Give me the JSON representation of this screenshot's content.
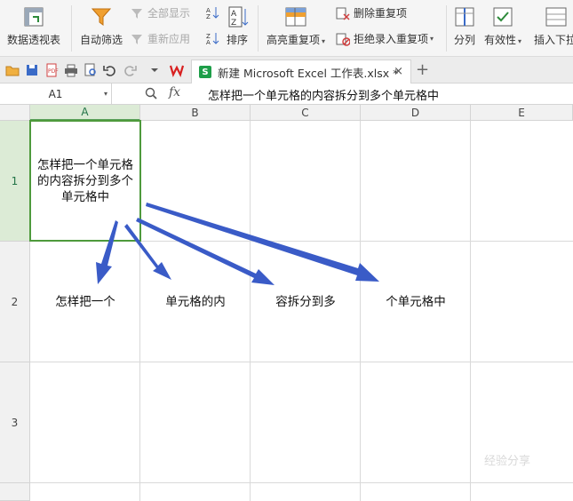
{
  "ribbon": {
    "pivot_table": "数据透视表",
    "auto_filter": "自动筛选",
    "show_all": "全部显示",
    "reapply": "重新应用",
    "sort": "排序",
    "highlight_duplicates": "高亮重复项",
    "delete_duplicates": "删除重复项",
    "reject_duplicates": "拒绝录入重复项",
    "split_column": "分列",
    "validity": "有效性",
    "insert_dropdown": "插入下拉"
  },
  "tabbar": {
    "doc_title": "新建 Microsoft Excel 工作表.xlsx *",
    "close_glyph": "×",
    "new_tab_glyph": "+",
    "xls_badge": "S"
  },
  "formula_bar": {
    "name_box": "A1",
    "fx": "fx",
    "content": "怎样把一个单元格的内容拆分到多个单元格中"
  },
  "columns": [
    "A",
    "B",
    "C",
    "D",
    "E"
  ],
  "rows": [
    "1",
    "2",
    "3"
  ],
  "cells": {
    "A1": "怎样把一个单元格的内容拆分到多个单元格中",
    "A2": "怎样把一个",
    "B2": "单元格的内",
    "C2": "容拆分到多",
    "D2": "个单元格中"
  },
  "selected": {
    "column": "A",
    "row": "1"
  },
  "colors": {
    "selection": "#4e9a3c",
    "arrow": "#3a5bc7"
  },
  "watermark": "经验分享"
}
